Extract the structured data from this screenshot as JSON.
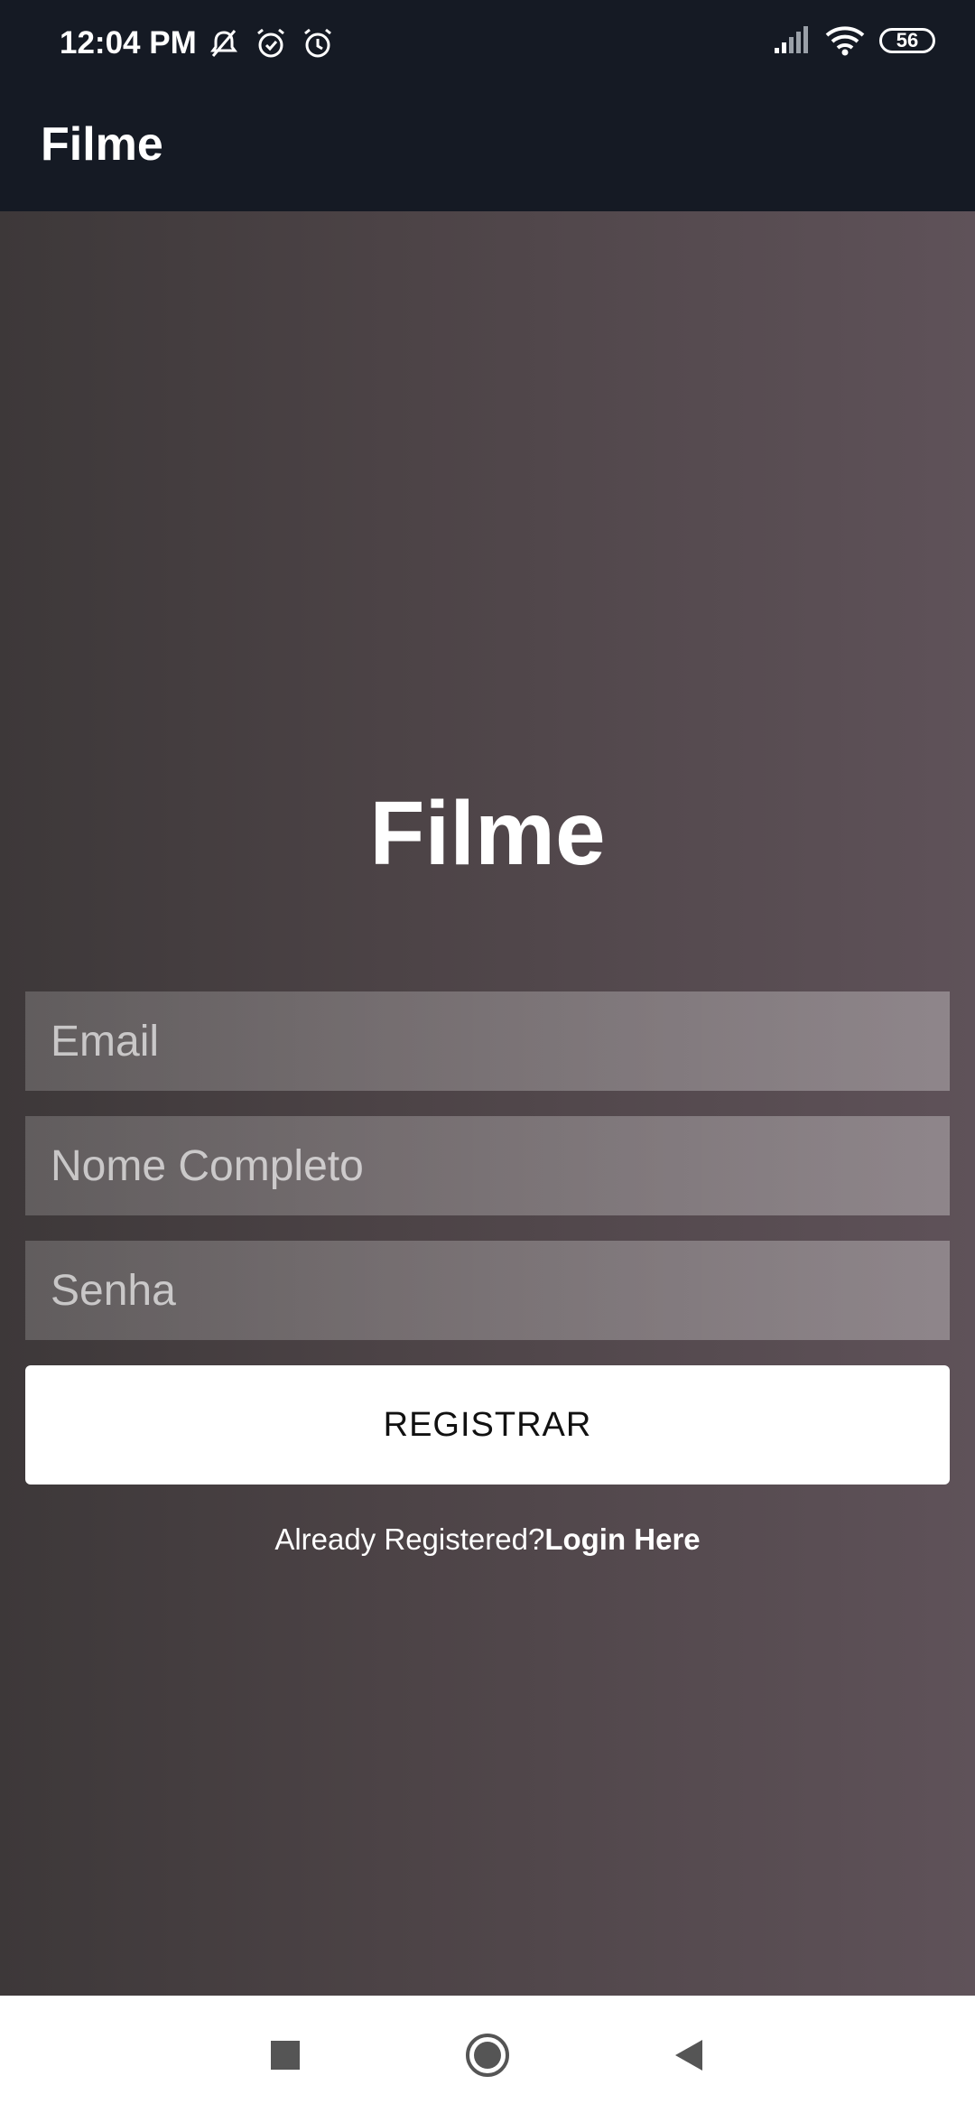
{
  "status_bar": {
    "time": "12:04 PM",
    "battery": "56",
    "icons_left": [
      "mute-icon",
      "alarm-icon",
      "alarm-icon"
    ],
    "icons_right": [
      "signal-icon",
      "wifi-icon",
      "battery-icon"
    ]
  },
  "app_bar": {
    "title": "Filme"
  },
  "form": {
    "brand": "Filme",
    "email": {
      "placeholder": "Email",
      "value": ""
    },
    "name": {
      "placeholder": "Nome Completo",
      "value": ""
    },
    "password": {
      "placeholder": "Senha",
      "value": ""
    },
    "submit_label": "REGISTRAR",
    "login_prompt": "Already Registered?",
    "login_link": "Login Here"
  },
  "nav_bar": {
    "buttons": [
      "recents-icon",
      "home-icon",
      "back-icon"
    ]
  },
  "colors": {
    "app_bar": "#151a24",
    "gradient_start": "#3d3839",
    "gradient_end": "#5f5259",
    "button": "#ffffff"
  }
}
